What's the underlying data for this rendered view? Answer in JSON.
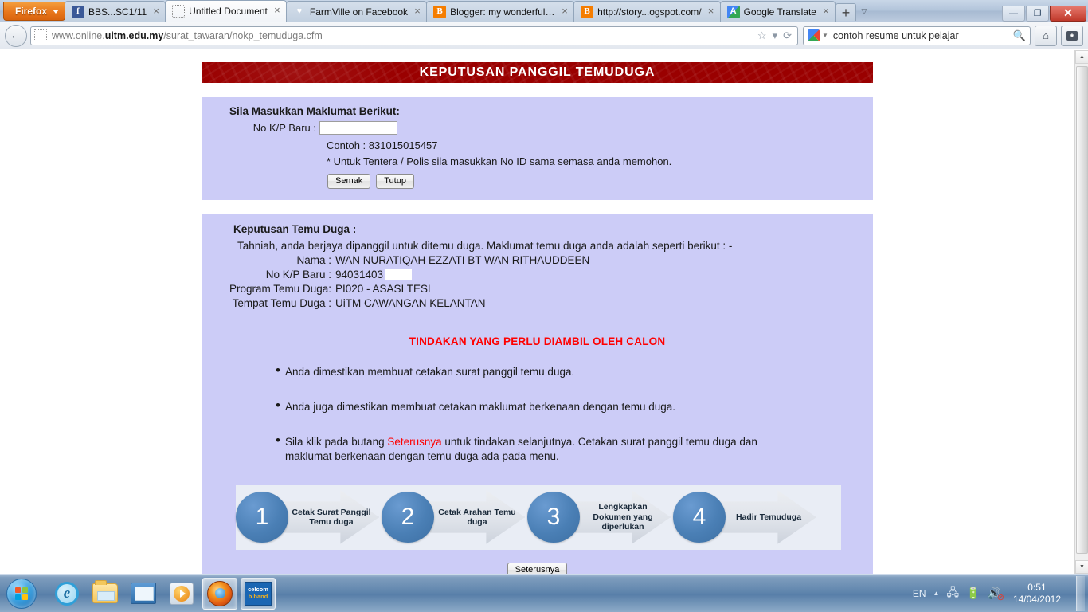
{
  "browser": {
    "firefox_button": "Firefox",
    "tabs": [
      {
        "label": "BBS...SC1/11",
        "icon": "facebook-icon",
        "active": false
      },
      {
        "label": "Untitled Document",
        "icon": "blank-document-icon",
        "active": true
      },
      {
        "label": "FarmVille on Facebook",
        "icon": "heart-icon",
        "active": false
      },
      {
        "label": "Blogger: my wonderful li...",
        "icon": "blogger-icon",
        "active": false
      },
      {
        "label": "http://story...ogspot.com/",
        "icon": "blogger-icon",
        "active": false
      },
      {
        "label": "Google Translate",
        "icon": "google-translate-icon",
        "active": false
      }
    ],
    "new_tab_label": "+",
    "list_all_tabs_label": "▽",
    "window_controls": {
      "minimize": "—",
      "restore": "❐",
      "close": "✕"
    },
    "back_button": "←",
    "url": {
      "prefix": "www.online.",
      "domain": "uitm.edu.my",
      "path": "/surat_tawaran/nokp_temuduga.cfm"
    },
    "url_icons": {
      "bookmark": "☆",
      "dropdown": "▾",
      "reload": "⟳"
    },
    "search": {
      "engine": "google-icon",
      "query": "contoh resume untuk pelajar",
      "magnifier": "🔍"
    },
    "home_button": "⌂",
    "bookmarks_button": "★"
  },
  "page": {
    "banner_title": "KEPUTUSAN PANGGIL TEMUDUGA",
    "form": {
      "heading": "Sila Masukkan Maklumat Berikut:",
      "field_label": "No K/P Baru :",
      "field_value": "",
      "field_placeholder": "",
      "example": "Contoh : 831015015457",
      "note": "* Untuk Tentera / Polis sila masukkan No ID sama semasa anda memohon.",
      "submit_label": "Semak",
      "close_label": "Tutup"
    },
    "result": {
      "heading": "Keputusan Temu Duga :",
      "intro": "Tahniah, anda berjaya dipanggil untuk ditemu duga. Maklumat temu duga anda adalah seperti berikut : -",
      "fields": [
        {
          "label": "Nama :",
          "value": "WAN NURATIQAH EZZATI BT WAN RITHAUDDEEN",
          "redacted": false
        },
        {
          "label": "No K/P Baru :",
          "value": "94031403",
          "redacted": true
        },
        {
          "label": "Program Temu Duga:",
          "value": "PI020 - ASASI TESL",
          "redacted": false
        },
        {
          "label": "Tempat Temu Duga :",
          "value": "UiTM CAWANGAN KELANTAN",
          "redacted": false
        }
      ],
      "action_heading": "TINDAKAN YANG PERLU DIAMBIL OLEH CALON",
      "bullets": [
        {
          "bullet": "•",
          "text": "Anda dimestikan membuat cetakan surat panggil temu duga.",
          "highlight": ""
        },
        {
          "bullet": "•",
          "text": "Anda juga dimestikan membuat cetakan maklumat berkenaan dengan temu duga.",
          "highlight": ""
        },
        {
          "bullet": "•",
          "text_before": "Sila klik pada butang ",
          "highlight": "Seterusnya",
          "text_after": " untuk tindakan selanjutnya. Cetakan surat panggil temu duga dan maklumat berkenaan dengan temu duga ada pada menu."
        }
      ],
      "flow_steps": [
        {
          "number": "1",
          "label": "Cetak Surat Panggil Temu duga"
        },
        {
          "number": "2",
          "label": "Cetak Arahan Temu duga"
        },
        {
          "number": "3",
          "label": "Lengkapkan Dokumen yang diperlukan"
        },
        {
          "number": "4",
          "label": "Hadir Temuduga"
        }
      ],
      "next_label": "Seterusnya"
    }
  },
  "taskbar": {
    "start_label": "Start",
    "items": [
      {
        "name": "internet-explorer-icon",
        "running": false
      },
      {
        "name": "windows-explorer-icon",
        "running": false
      },
      {
        "name": "paint-icon",
        "running": false
      },
      {
        "name": "windows-media-player-icon",
        "running": false
      },
      {
        "name": "firefox-icon",
        "running": true
      },
      {
        "name": "celcom-broadband-icon",
        "running": true
      }
    ],
    "celcom": {
      "line1": "celcom",
      "line2": "b.band"
    },
    "tray": {
      "language": "EN",
      "show_hidden": "▲",
      "network_icon": "🖧",
      "battery_icon": "🔋",
      "volume_icon": "🔊",
      "time": "0:51",
      "date": "14/04/2012"
    }
  }
}
